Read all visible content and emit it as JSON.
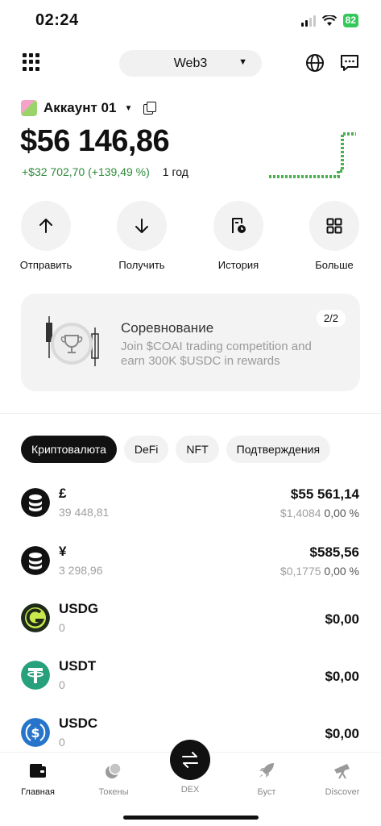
{
  "status": {
    "time": "02:24",
    "battery": "82"
  },
  "header": {
    "network": "Web3"
  },
  "account": {
    "name": "Аккаунт 01"
  },
  "portfolio": {
    "balance": "$56 146,86",
    "pnl": "+$32 702,70 (+139,49 %)",
    "period": "1 год"
  },
  "actions": [
    {
      "label": "Отправить",
      "icon": "arrow-up-icon"
    },
    {
      "label": "Получить",
      "icon": "arrow-down-icon"
    },
    {
      "label": "История",
      "icon": "history-icon"
    },
    {
      "label": "Больше",
      "icon": "grid-icon"
    }
  ],
  "promo": {
    "title": "Соревнование",
    "text": "Join $COAI trading competition and earn 300K $USDC in rewards",
    "badge": "2/2"
  },
  "filters": [
    "Криптовалюта",
    "DeFi",
    "NFT",
    "Подтверждения"
  ],
  "active_filter": "Криптовалюта",
  "tokens": [
    {
      "name": "£",
      "amount": "39 448,81",
      "value": "$55 561,14",
      "price": "$1,4084",
      "change": "0,00 %",
      "icon": "stack-coin-icon"
    },
    {
      "name": "¥",
      "amount": "3 298,96",
      "value": "$585,56",
      "price": "$0,1775",
      "change": "0,00 %",
      "icon": "stack-coin-icon"
    },
    {
      "name": "USDG",
      "amount": "0",
      "value": "$0,00",
      "icon": "usdg-icon"
    },
    {
      "name": "USDT",
      "amount": "0",
      "value": "$0,00",
      "icon": "usdt-icon"
    },
    {
      "name": "USDC",
      "amount": "0",
      "value": "$0,00",
      "icon": "usdc-icon"
    }
  ],
  "nav": {
    "home": "Главная",
    "tokens": "Токены",
    "dex": "DEX",
    "boost": "Буст",
    "discover": "Discover"
  },
  "colors": {
    "positive": "#2e8b3a",
    "sparkline": "#4caf50",
    "usdg": "#c9e84b",
    "usdt": "#26a17b",
    "usdc": "#2775ca",
    "battery": "#34c759"
  }
}
